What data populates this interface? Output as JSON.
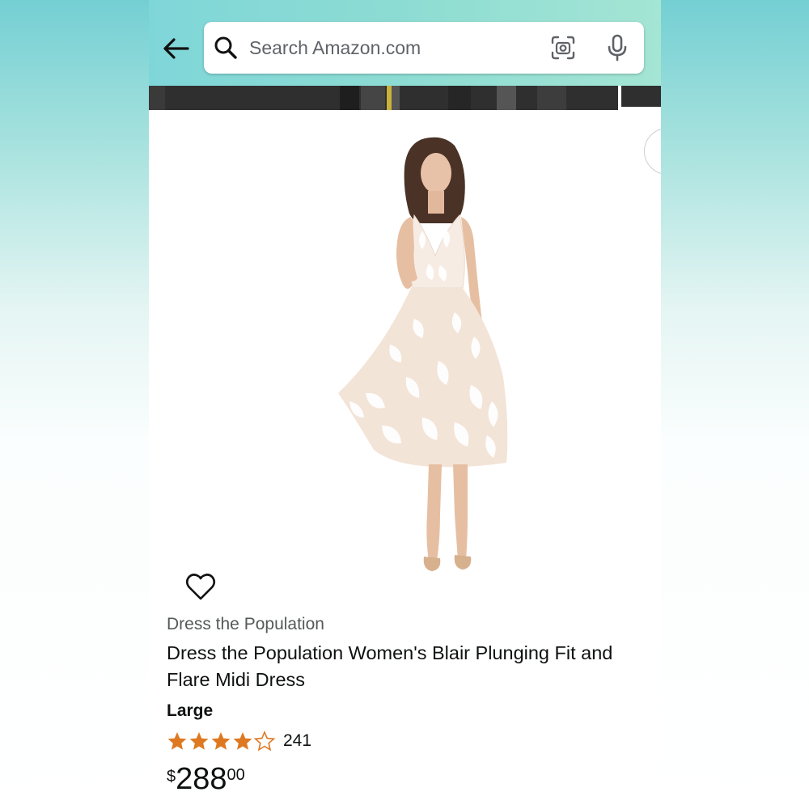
{
  "search": {
    "placeholder": "Search Amazon.com"
  },
  "icons": {
    "back": "arrow-left-icon",
    "search": "search-icon",
    "lens": "camera-lens-icon",
    "mic": "microphone-icon",
    "wishlist": "heart-icon",
    "share": "share-icon"
  },
  "product": {
    "brand": "Dress the Population",
    "title": "Dress the Population Women's Blair Plunging Fit and Flare Midi Dress",
    "size": "Large",
    "rating": {
      "stars": 4.5,
      "count": "241"
    },
    "price": {
      "symbol": "$",
      "whole": "288",
      "fraction": "00"
    }
  },
  "colors": {
    "header_start": "#7fd6d8",
    "header_end": "#a4e5d4",
    "star": "#de7921",
    "text": "#0f1111",
    "muted": "#565959"
  }
}
